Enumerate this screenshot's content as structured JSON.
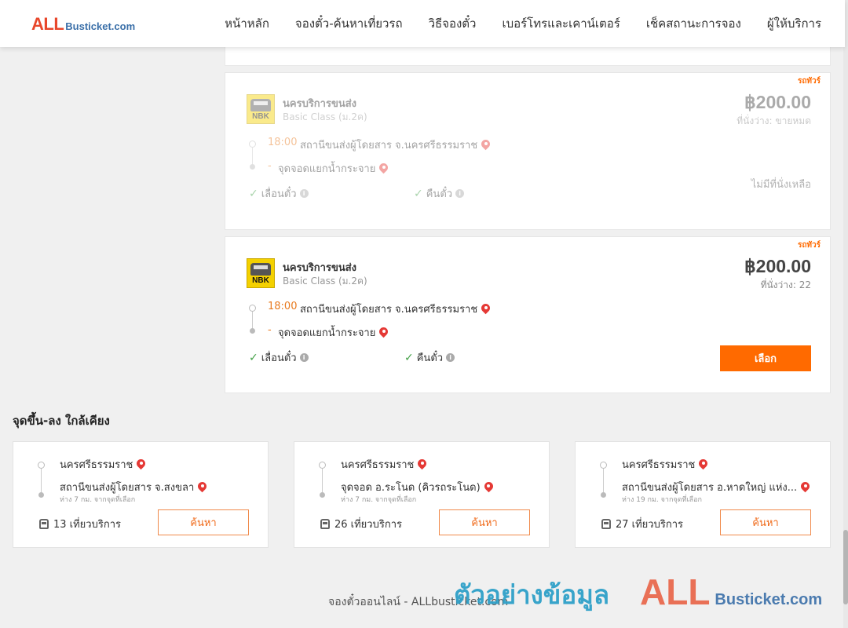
{
  "header": {
    "logo": {
      "all": "ALL",
      "busticket": "Busticket.com"
    },
    "nav": [
      "หน้าหลัก",
      "จองตั๋ว-ค้นหาเที่ยวรถ",
      "วิธีจองตั๋ว",
      "เบอร์โทรและเคาน์เตอร์",
      "เช็คสถานะการจอง",
      "ผู้ให้บริการ"
    ]
  },
  "trips": [
    {
      "tag": "รถทัวร์",
      "operator_logo_text": "NBK",
      "operator": "นครบริการขนส่ง",
      "class": "Basic Class (ม.2ค)",
      "price": "฿200.00",
      "seats": "ที่นั่งว่าง: ขายหมด",
      "departure_time": "18:00",
      "departure_station": "สถานีขนส่งผู้โดยสาร จ.นครศรีธรรมราช",
      "arrival_dash": "-",
      "arrival_station": "จุดจอดแยกน้ำกระจาย",
      "feature_1": "เลื่อนตั๋ว",
      "feature_2": "คืนตั๋ว",
      "status": "ไม่มีที่นั่งเหลือ",
      "sold_out": true
    },
    {
      "tag": "รถทัวร์",
      "operator_logo_text": "NBK",
      "operator": "นครบริการขนส่ง",
      "class": "Basic Class (ม.2ค)",
      "price": "฿200.00",
      "seats": "ที่นั่งว่าง: 22",
      "departure_time": "18:00",
      "departure_station": "สถานีขนส่งผู้โดยสาร จ.นครศรีธรรมราช",
      "arrival_dash": "-",
      "arrival_station": "จุดจอดแยกน้ำกระจาย",
      "feature_1": "เลื่อนตั๋ว",
      "feature_2": "คืนตั๋ว",
      "button": "เลือก",
      "sold_out": false
    }
  ],
  "nearby": {
    "title": "จุดขึ้น-ลง ใกล้เคียง",
    "cards": [
      {
        "from": "นครศรีธรรมราช",
        "to": "สถานีขนส่งผู้โดยสาร จ.สงขลา",
        "distance": "ห่าง 7 กม. จากจุดที่เลือก",
        "trips": "13 เที่ยวบริการ",
        "button": "ค้นหา"
      },
      {
        "from": "นครศรีธรรมราช",
        "to": "จุดจอด อ.ระโนด (คิวรถระโนด)",
        "distance": "ห่าง 7 กม. จากจุดที่เลือก",
        "trips": "26 เที่ยวบริการ",
        "button": "ค้นหา"
      },
      {
        "from": "นครศรีธรรมราช",
        "to": "สถานีขนส่งผู้โดยสาร อ.หาดใหญ่ แห่ง...",
        "distance": "ห่าง 19 กม. จากจุดที่เลือก",
        "trips": "27 เที่ยวบริการ",
        "button": "ค้นหา"
      }
    ]
  },
  "footer": {
    "text": "จองตั๋วออนไลน์ - ALLbusticket.com"
  },
  "watermark": {
    "text": "ตัวอย่างข้อมูล",
    "logo_all": "ALL",
    "logo_busticket": "Busticket.com"
  },
  "colors": {
    "accent": "#ff6a00",
    "time": "#e87a1e",
    "pin": "#e53935",
    "check": "#43a047"
  }
}
